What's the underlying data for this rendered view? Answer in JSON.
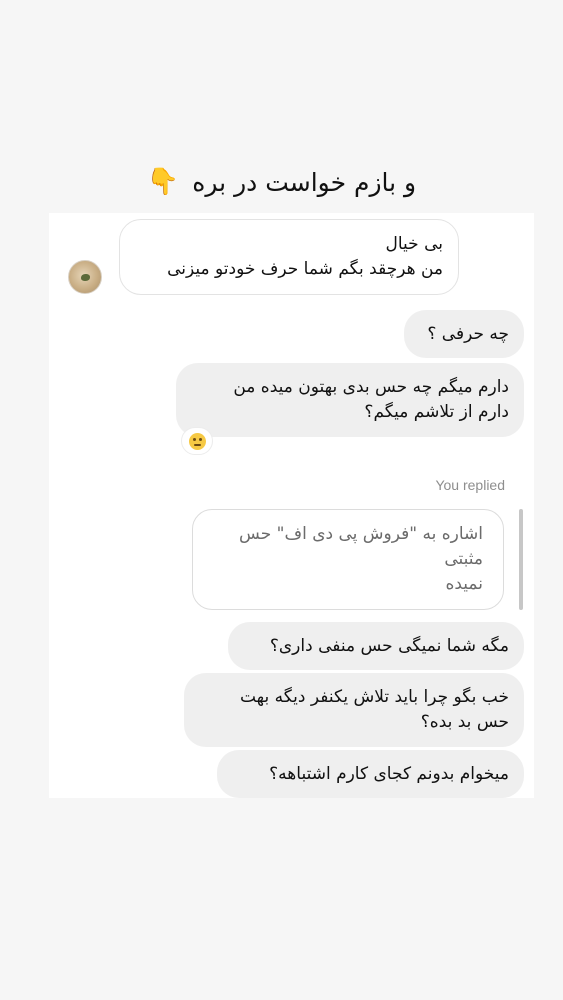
{
  "story": {
    "caption_text": "و بازم خواست در بره",
    "caption_emoji": "👇"
  },
  "chat": {
    "incoming": {
      "line1": "بی خیال",
      "line2": "من هرچقد بگم شما حرف خودتو میزنی"
    },
    "outgoing": [
      {
        "line1": "چه حرفی ؟"
      },
      {
        "line1": "دارم میگم چه حس بدی بهتون میده من",
        "line2": "دارم از تلاشم میگم؟"
      }
    ],
    "reaction_icon": "neutral-face-emoji",
    "replied_label": "You replied",
    "quote": {
      "line1": "اشاره به \"فروش پی دی اف\" حس مثبتی",
      "line2": "نمیده"
    },
    "replies": [
      {
        "line1": "مگه شما نمیگی حس منفی داری؟"
      },
      {
        "line1": "خب بگو چرا باید تلاش یکنفر دیگه بهت",
        "line2": "حس بد بده؟"
      },
      {
        "line1": "میخوام بدونم کجای کارم اشتباهه؟"
      }
    ]
  },
  "colors": {
    "page_background": "#f6f6f6",
    "card_background": "#ffffff",
    "bubble_background": "#efefef",
    "muted_text": "#8e8e8e"
  }
}
